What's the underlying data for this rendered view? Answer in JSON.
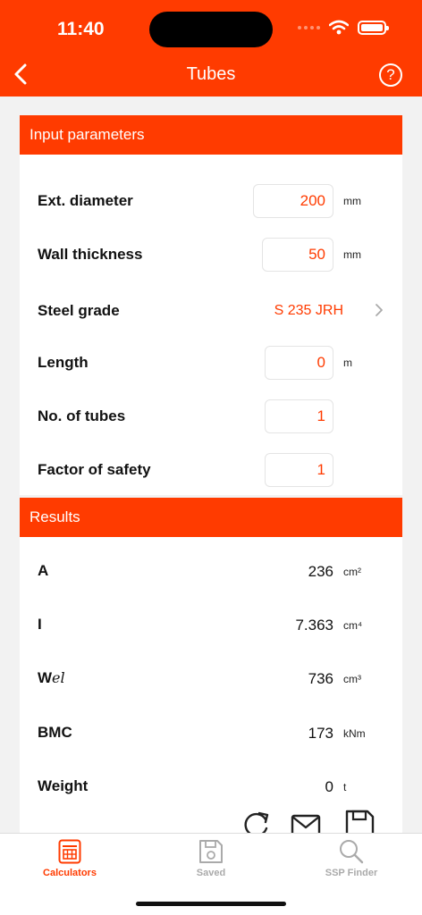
{
  "status_bar": {
    "time": "11:40"
  },
  "nav": {
    "title": "Tubes",
    "help_symbol": "?"
  },
  "colors": {
    "accent": "#ff3b00",
    "background": "#f2f2f2",
    "card": "#ffffff",
    "tab_inactive": "#aaaaaa"
  },
  "input_section": {
    "title": "Input parameters",
    "ext_diameter": {
      "label": "Ext. diameter",
      "value": "200",
      "unit": "mm"
    },
    "wall_thickness": {
      "label": "Wall thickness",
      "value": "50",
      "unit": "mm"
    },
    "steel_grade": {
      "label": "Steel grade",
      "value": "S 235 JRH"
    },
    "length": {
      "label": "Length",
      "value": "0",
      "unit": "m"
    },
    "num_tubes": {
      "label": "No. of tubes",
      "value": "1"
    },
    "factor_safety": {
      "label": "Factor of safety",
      "value": "1"
    }
  },
  "results_section": {
    "title": "Results",
    "a": {
      "label": "A",
      "value": "236",
      "unit": "cm²"
    },
    "i": {
      "label": "I",
      "value": "7.363",
      "unit": "cm⁴"
    },
    "wel": {
      "label_main": "W",
      "label_sub": "el",
      "value": "736",
      "unit": "cm³"
    },
    "bmc": {
      "label": "BMC",
      "value": "173",
      "unit": "kNm"
    },
    "weight": {
      "label": "Weight",
      "value": "0",
      "unit": "t"
    }
  },
  "actions": {
    "icons": [
      "refresh-icon",
      "mail-icon",
      "save-icon"
    ]
  },
  "tabbar": {
    "calculators": "Calculators",
    "saved": "Saved",
    "ssp_finder": "SSP Finder"
  }
}
